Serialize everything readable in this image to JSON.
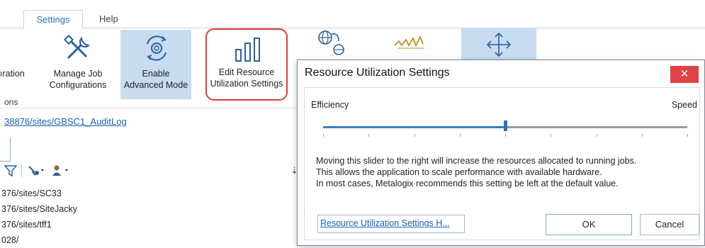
{
  "tabs": [
    {
      "label": "Settings",
      "active": true
    },
    {
      "label": "Help",
      "active": false
    }
  ],
  "ribbon": {
    "partial_label": "ıration",
    "buttons": [
      {
        "name": "manage-job-configurations",
        "label_line1": "Manage Job",
        "label_line2": "Configurations",
        "icon": "tools-icon"
      },
      {
        "name": "enable-advanced-mode",
        "label_line1": "Enable",
        "label_line2": "Advanced Mode",
        "icon": "gear-cycle-icon",
        "selected": true
      },
      {
        "name": "edit-resource-utilization-settings",
        "label_line1": "Edit Resource",
        "label_line2": "Utilization Settings",
        "icon": "bar-chart-icon",
        "highlighted": true
      }
    ],
    "group_label": "ons",
    "extra_icons": [
      "globe-link-icon",
      "signature-icon",
      "move-arrows-icon"
    ]
  },
  "path_link": "38876/sites/GBSC1_AuditLog",
  "tree_items": [
    "376/sites/SC33",
    "376/sites/SiteJacky",
    "376/sites/tff1",
    "028/"
  ],
  "dialog": {
    "title": "Resource Utilization Settings",
    "close_glyph": "✕",
    "left_label": "Efficiency",
    "right_label": "Speed",
    "slider_value": 0.5,
    "description": [
      "Moving this slider to the right will increase the resources allocated to running jobs.",
      "This allows the application to scale performance with available hardware.",
      "In most cases, Metalogix recommends this setting be left at the default value."
    ],
    "help_link": "Resource Utilization Settings H...",
    "ok_label": "OK",
    "cancel_label": "Cancel"
  },
  "colors": {
    "accent": "#2d6fb8",
    "close_button": "#e04343",
    "highlight_outline": "#e03b3b",
    "selected_button_bg": "#c7dcf0"
  }
}
